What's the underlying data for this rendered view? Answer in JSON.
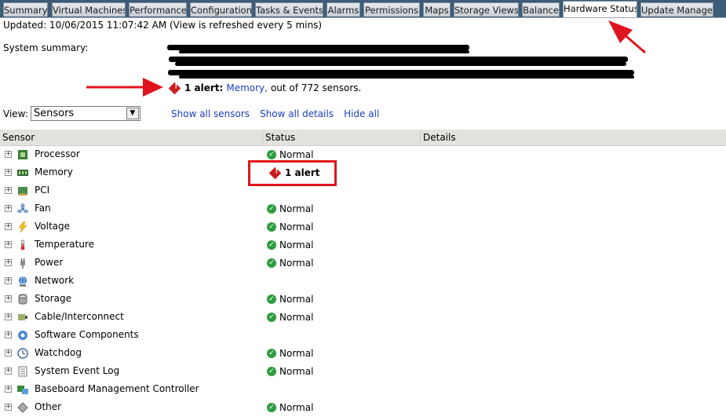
{
  "tabs": [
    {
      "label": "Summary",
      "active": false
    },
    {
      "label": "Virtual Machines",
      "active": false
    },
    {
      "label": "Performance",
      "active": false
    },
    {
      "label": "Configuration",
      "active": false
    },
    {
      "label": "Tasks & Events",
      "active": false
    },
    {
      "label": "Alarms",
      "active": false
    },
    {
      "label": "Permissions",
      "active": false
    },
    {
      "label": "Maps",
      "active": false
    },
    {
      "label": "Storage Views",
      "active": false
    },
    {
      "label": "Balance",
      "active": false
    },
    {
      "label": "Hardware Status",
      "active": true
    },
    {
      "label": "Update Manager",
      "active": false
    }
  ],
  "header": {
    "updated_text": "Updated: 10/06/2015  11:07:42 AM (View is refreshed every 5 mins)",
    "system_summary_label": "System summary:",
    "alert_count": "1 alert:",
    "alert_link": "Memory,",
    "alert_rest": "out of 772 sensors."
  },
  "view": {
    "label": "View:",
    "selected": "Sensors",
    "links": [
      "Show all sensors",
      "Show all details",
      "Hide all"
    ]
  },
  "table": {
    "columns": [
      "Sensor",
      "Status",
      "Details"
    ],
    "rows": [
      {
        "name": "Processor",
        "status": "Normal",
        "icon": "processor-icon"
      },
      {
        "name": "Memory",
        "status": "1 alert",
        "icon": "memory-icon"
      },
      {
        "name": "PCI",
        "status": "",
        "icon": "pci-icon"
      },
      {
        "name": "Fan",
        "status": "Normal",
        "icon": "fan-icon"
      },
      {
        "name": "Voltage",
        "status": "Normal",
        "icon": "voltage-icon"
      },
      {
        "name": "Temperature",
        "status": "Normal",
        "icon": "temperature-icon"
      },
      {
        "name": "Power",
        "status": "Normal",
        "icon": "power-icon"
      },
      {
        "name": "Network",
        "status": "",
        "icon": "network-icon"
      },
      {
        "name": "Storage",
        "status": "Normal",
        "icon": "storage-icon"
      },
      {
        "name": "Cable/Interconnect",
        "status": "Normal",
        "icon": "cable-icon"
      },
      {
        "name": "Software Components",
        "status": "",
        "icon": "software-icon"
      },
      {
        "name": "Watchdog",
        "status": "Normal",
        "icon": "watchdog-icon"
      },
      {
        "name": "System Event Log",
        "status": "Normal",
        "icon": "event-log-icon"
      },
      {
        "name": "Baseboard Management Controller",
        "status": "",
        "icon": "bmc-icon"
      },
      {
        "name": "Other",
        "status": "Normal",
        "icon": "other-icon"
      }
    ]
  },
  "colors": {
    "alert": "#c81e1e",
    "normal": "#2e9e3e",
    "annotation": "#e0141c",
    "link": "#1a3fbf"
  }
}
